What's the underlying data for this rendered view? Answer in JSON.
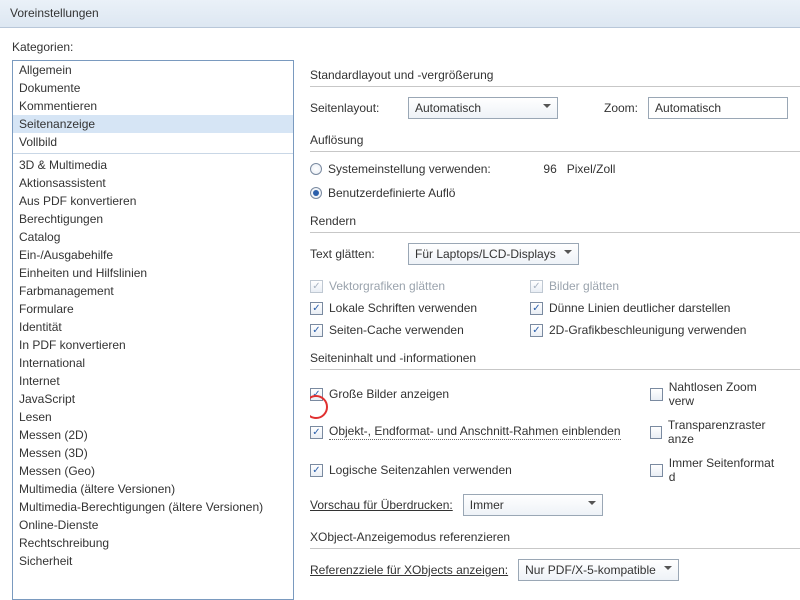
{
  "window": {
    "title": "Voreinstellungen"
  },
  "categories_label": "Kategorien:",
  "categories": {
    "group1": [
      "Allgemein",
      "Dokumente",
      "Kommentieren",
      "Seitenanzeige",
      "Vollbild"
    ],
    "selected_index": 3,
    "group2": [
      "3D & Multimedia",
      "Aktionsassistent",
      "Aus PDF konvertieren",
      "Berechtigungen",
      "Catalog",
      "Ein-/Ausgabehilfe",
      "Einheiten und Hilfslinien",
      "Farbmanagement",
      "Formulare",
      "Identität",
      "In PDF konvertieren",
      "International",
      "Internet",
      "JavaScript",
      "Lesen",
      "Messen (2D)",
      "Messen (3D)",
      "Messen (Geo)",
      "Multimedia (ältere Versionen)",
      "Multimedia-Berechtigungen (ältere Versionen)",
      "Online-Dienste",
      "Rechtschreibung",
      "Sicherheit"
    ]
  },
  "layout_group": {
    "title": "Standardlayout und -vergrößerung",
    "page_layout_label": "Seitenlayout:",
    "page_layout_value": "Automatisch",
    "zoom_label": "Zoom:",
    "zoom_value": "Automatisch"
  },
  "resolution_group": {
    "title": "Auflösung",
    "system_label": "Systemeinstellung verwenden:",
    "system_value": "96",
    "system_unit": "Pixel/Zoll",
    "custom_label": "Benutzerdefinierte Auflö"
  },
  "render_group": {
    "title": "Rendern",
    "smooth_text_label": "Text glätten:",
    "smooth_text_value": "Für Laptops/LCD-Displays",
    "vector_smooth": "Vektorgrafiken glätten",
    "images_smooth": "Bilder glätten",
    "local_fonts": "Lokale Schriften verwenden",
    "thin_lines": "Dünne Linien deutlicher darstellen",
    "page_cache": "Seiten-Cache verwenden",
    "gfx_accel": "2D-Grafikbeschleunigung verwenden"
  },
  "content_group": {
    "title": "Seiteninhalt und -informationen",
    "large_images": "Große Bilder anzeigen",
    "seamless_zoom": "Nahtlosen Zoom verw",
    "boxes": "Objekt-, Endformat- und Anschnitt-Rahmen einblenden",
    "transparency": "Transparenzraster anze",
    "logical_pages": "Logische Seitenzahlen verwenden",
    "page_format": "Immer Seitenformat d",
    "overprint_label": "Vorschau für Überdrucken:",
    "overprint_value": "Immer"
  },
  "xobject_group": {
    "title": "XObject-Anzeigemodus referenzieren",
    "targets_label": "Referenzziele für XObjects anzeigen:",
    "targets_value": "Nur PDF/X-5-kompatible"
  }
}
